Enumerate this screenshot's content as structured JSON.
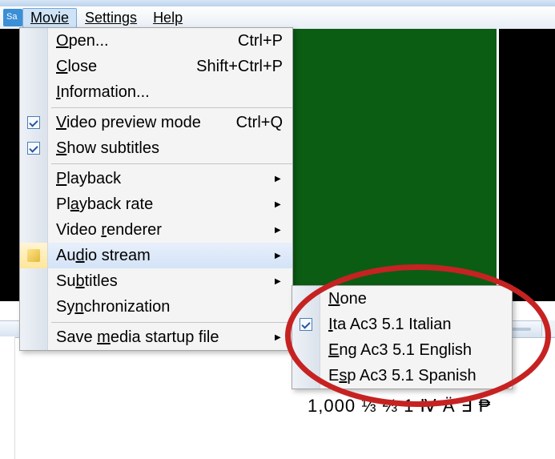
{
  "menubar": {
    "items": [
      {
        "label": "Movie"
      },
      {
        "label": "Settings"
      },
      {
        "label": "Help"
      }
    ]
  },
  "movie_menu": {
    "items": [
      {
        "label": "Open...",
        "shortcut": "Ctrl+P",
        "mnemonic_html": "<span class='u'>O</span>pen..."
      },
      {
        "label": "Close",
        "shortcut": "Shift+Ctrl+P",
        "mnemonic_html": "<span class='u'>C</span>lose"
      },
      {
        "label": "Information...",
        "mnemonic_html": "<span class='u'>I</span>nformation..."
      }
    ],
    "group2": [
      {
        "label": "Video preview mode",
        "shortcut": "Ctrl+Q",
        "checked": true,
        "mnemonic_html": "<span class='u'>V</span>ideo preview mode"
      },
      {
        "label": "Show subtitles",
        "checked": true,
        "mnemonic_html": "<span class='u'>S</span>how subtitles"
      }
    ],
    "group3": [
      {
        "label": "Playback",
        "submenu": true,
        "mnemonic_html": "<span class='u'>P</span>layback"
      },
      {
        "label": "Playback rate",
        "submenu": true,
        "mnemonic_html": "Pl<span class='u'>a</span>yback rate"
      },
      {
        "label": "Video renderer",
        "submenu": true,
        "mnemonic_html": "Video <span class='u'>r</span>enderer"
      },
      {
        "label": "Audio stream",
        "submenu": true,
        "highlight": true,
        "icon": "note-icon",
        "mnemonic_html": "Au<span class='u'>d</span>io stream"
      },
      {
        "label": "Subtitles",
        "submenu": true,
        "mnemonic_html": "Su<span class='u'>b</span>titles"
      },
      {
        "label": "Synchronization",
        "mnemonic_html": "Sy<span class='u'>n</span>chronization"
      }
    ],
    "group4": [
      {
        "label": "Save media startup file",
        "submenu": true,
        "mnemonic_html": "Save <span class='u'>m</span>edia startup file"
      }
    ]
  },
  "audio_submenu": {
    "items": [
      {
        "label": "None",
        "mnemonic_html": "<span class='u'>N</span>one"
      },
      {
        "label": "Ita Ac3 5.1 Italian",
        "checked": true,
        "mnemonic_html": "<span class='u'>I</span>ta Ac3 5.1 Italian"
      },
      {
        "label": "Eng Ac3 5.1 English",
        "mnemonic_html": "<span class='u'>E</span>ng Ac3 5.1 English"
      },
      {
        "label": "Esp Ac3 5.1 Spanish",
        "mnemonic_html": "E<span class='u'>s</span>p Ac3 5.1 Spanish"
      }
    ]
  },
  "undertext": "1,000  ⅓ ⅔ 1 Ⅳ Ä ∃ ₱"
}
